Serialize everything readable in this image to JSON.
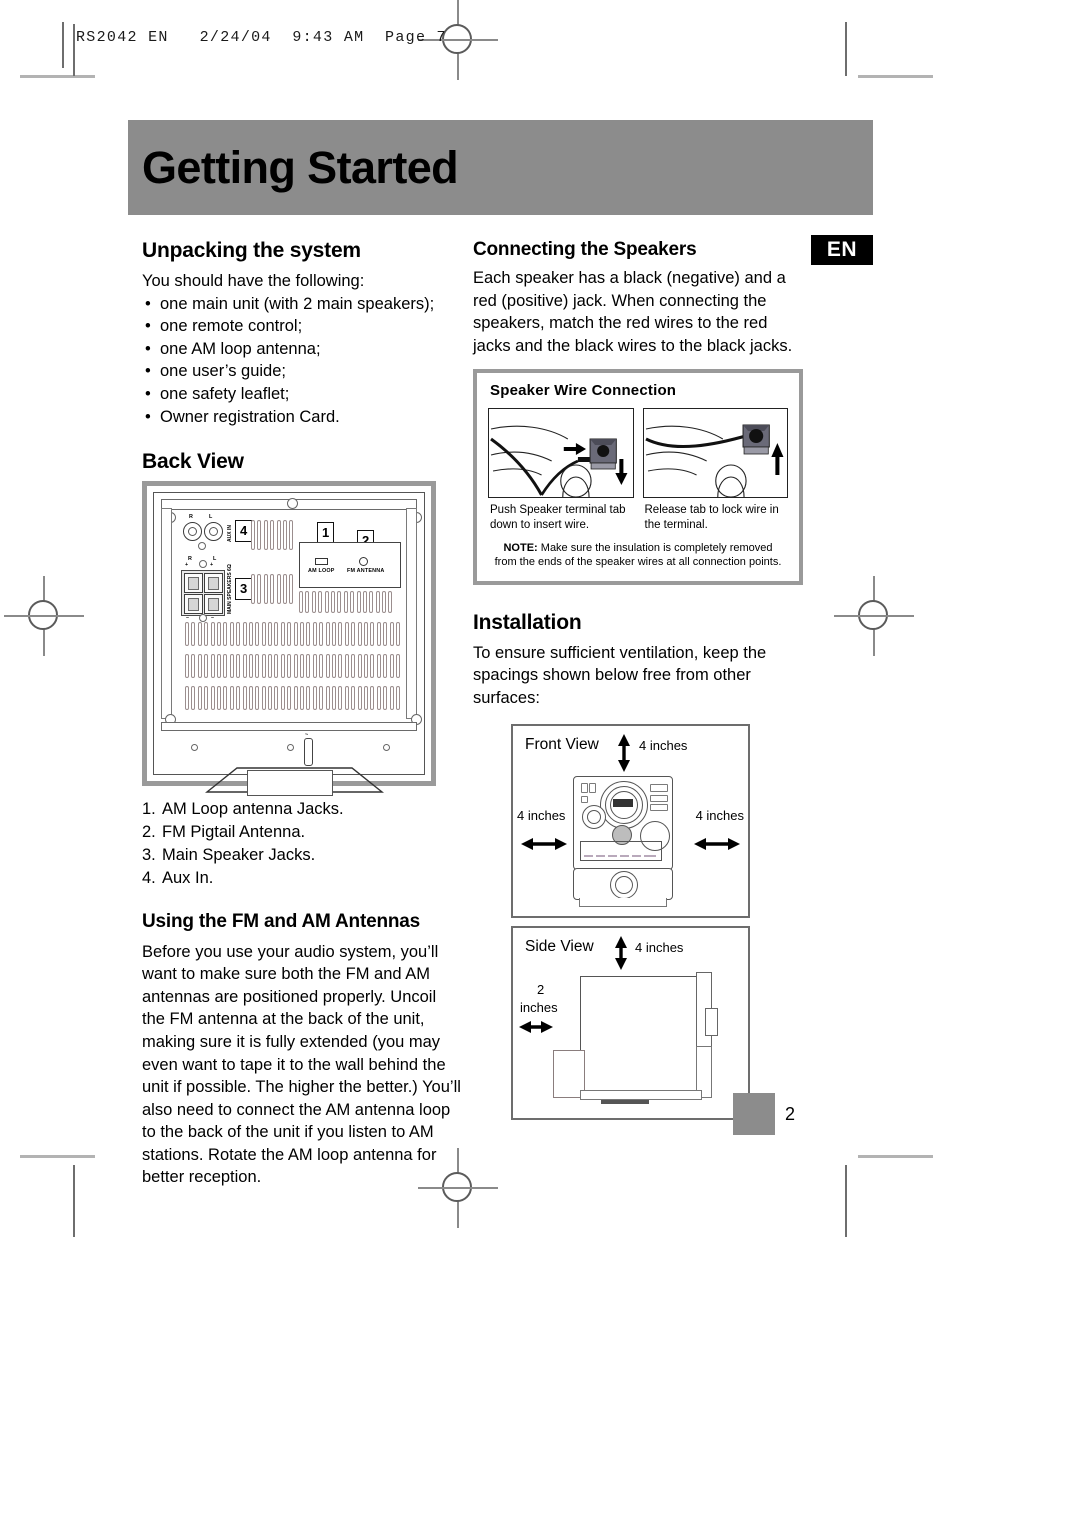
{
  "slug": {
    "text": "RS2042 EN   2/24/04  9:43 AM  Page 7"
  },
  "header": {
    "title": "Getting Started"
  },
  "language_badge": {
    "label": "EN"
  },
  "left_column": {
    "unpacking": {
      "heading": "Unpacking the system",
      "intro": "You should have the following:",
      "items": [
        "one main unit (with 2 main speakers);",
        "one remote control;",
        "one AM loop antenna;",
        "one user’s guide;",
        "one safety leaflet;",
        "Owner registration Card."
      ]
    },
    "back_view": {
      "heading": "Back View",
      "diagram": {
        "labels": {
          "rca_right": "R",
          "rca_left": "L",
          "aux_in": "AUX IN",
          "speaker_right": "R",
          "speaker_left": "L",
          "plus": "+",
          "minus": "–",
          "main_speakers": "MAIN SPEAKERS 6Ω",
          "am_loop": "AM LOOP",
          "fm_antenna": "FM ANTENNA",
          "power": "~"
        },
        "callouts": [
          "1",
          "2",
          "3",
          "4"
        ]
      },
      "legend": [
        {
          "n": "1.",
          "text": "AM Loop antenna Jacks."
        },
        {
          "n": "2.",
          "text": "FM Pigtail Antenna."
        },
        {
          "n": "3.",
          "text": "Main Speaker Jacks."
        },
        {
          "n": "4.",
          "text": "Aux In."
        }
      ]
    },
    "antennas": {
      "heading": "Using the FM and AM Antennas",
      "body": "Before you use your audio system, you’ll want to make sure both the FM and AM antennas are positioned properly.  Uncoil the FM antenna at the back of the unit, making sure it is fully extended (you may even want to tape it to the wall behind the unit if possible. The higher the better.) You’ll also need to connect the AM antenna loop to the back of the unit if you listen to AM stations. Rotate the AM loop antenna for better reception."
    }
  },
  "right_column": {
    "connecting": {
      "heading": "Connecting the Speakers",
      "body": "Each speaker has a black (negative) and a red (positive) jack.  When connecting the speakers, match the red wires to the red jacks and the black wires to the black jacks."
    },
    "wire_box": {
      "heading": "Speaker  Wire Connection",
      "captions": [
        "Push Speaker terminal tab down to insert wire.",
        "Release tab to lock wire in the terminal."
      ],
      "note_label": "NOTE:",
      "note_text": "Make sure the insulation  is completely removed from the ends of the speaker wires at all connection  points."
    },
    "installation": {
      "heading": "Installation",
      "body": "To ensure sufficient ventilation, keep the spacings shown below free from other surfaces:",
      "front_view": {
        "label": "Front View",
        "top": "4 inches",
        "left": "4 inches",
        "right": "4 inches"
      },
      "side_view": {
        "label": "Side View",
        "top": "4 inches",
        "left_line1": "2",
        "left_line2": "inches"
      }
    }
  },
  "footer": {
    "page_number": "2"
  },
  "colors": {
    "band_gray": "#8c8c8c",
    "box_border_gray": "#9a9a9a",
    "badge_black": "#000000",
    "mark_gray": "#b3b3b3"
  }
}
